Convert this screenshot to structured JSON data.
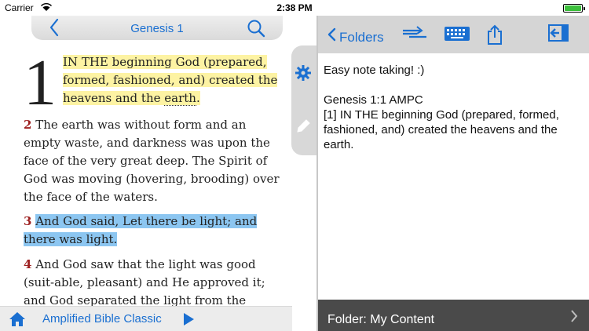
{
  "status_bar": {
    "carrier": "Carrier",
    "time": "2:38 PM"
  },
  "reader": {
    "title": "Genesis 1",
    "chapter_number": "1",
    "verse1": "IN THE beginning God (prepared, formed, fashioned, and) created the heavens and the earth.",
    "verse1_noted": "earth",
    "verses": [
      {
        "num": "2",
        "text": "The earth was without form and an empty waste, and darkness was upon the face of the very great deep. The Spirit of God was moving (hovering, brooding) over the face of the waters."
      },
      {
        "num": "3",
        "text": "And God said, Let there be light; and there was light."
      },
      {
        "num": "4",
        "text": "And God saw that the light was good (suit-able, pleasant) and He approved it; and God separated the light from the darkness."
      }
    ],
    "book_name": "Amplified Bible Classic",
    "icons": {
      "back": "chevron-left-icon",
      "search": "search-icon",
      "home": "home-icon",
      "play": "play-icon"
    }
  },
  "side_tabs": {
    "icons": [
      "gear-icon",
      "pencil-icon"
    ]
  },
  "notes": {
    "folders_label": "Folders",
    "note_line1": "Easy note taking! :)",
    "note_ref": "Genesis 1:1 AMPC",
    "note_body": "[1] IN THE beginning God (prepared, formed, fashioned, and) created the heavens and the earth.",
    "folder_label": "Folder: My Content",
    "icons": [
      "sync-icon",
      "keyboard-icon",
      "share-icon",
      "collapse-icon"
    ]
  },
  "colors": {
    "accent": "#1a6fd1",
    "highlight_yellow": "#fdf3a3",
    "highlight_blue": "#8cc6f1",
    "verse_number": "#9d1f1f"
  }
}
